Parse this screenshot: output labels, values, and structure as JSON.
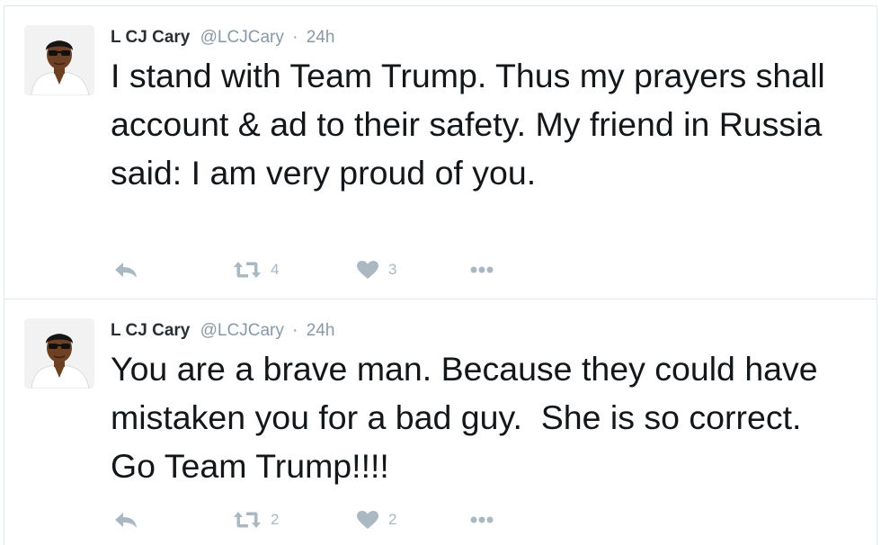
{
  "colors": {
    "name": "#292f33",
    "meta": "#8899a6",
    "text": "#14171a",
    "icon": "#aab8c2",
    "divider": "#e1e8ed"
  },
  "tweets": [
    {
      "name": "L CJ Cary",
      "handle": "@LCJCary",
      "separator": "·",
      "time": "24h",
      "text": "I stand with Team Trump. Thus my prayers shall account & ad to their safety. My friend in Russia said: I am very proud of you.",
      "retweets": "4",
      "likes": "3",
      "icons": [
        "reply-icon",
        "retweet-icon",
        "heart-icon",
        "more-icon"
      ]
    },
    {
      "name": "L CJ Cary",
      "handle": "@LCJCary",
      "separator": "·",
      "time": "24h",
      "text": "You are a brave man. Because they could have mistaken you for a bad guy.  She is so correct.  Go Team Trump!!!!",
      "retweets": "2",
      "likes": "2",
      "icons": [
        "reply-icon",
        "retweet-icon",
        "heart-icon",
        "more-icon"
      ]
    }
  ]
}
